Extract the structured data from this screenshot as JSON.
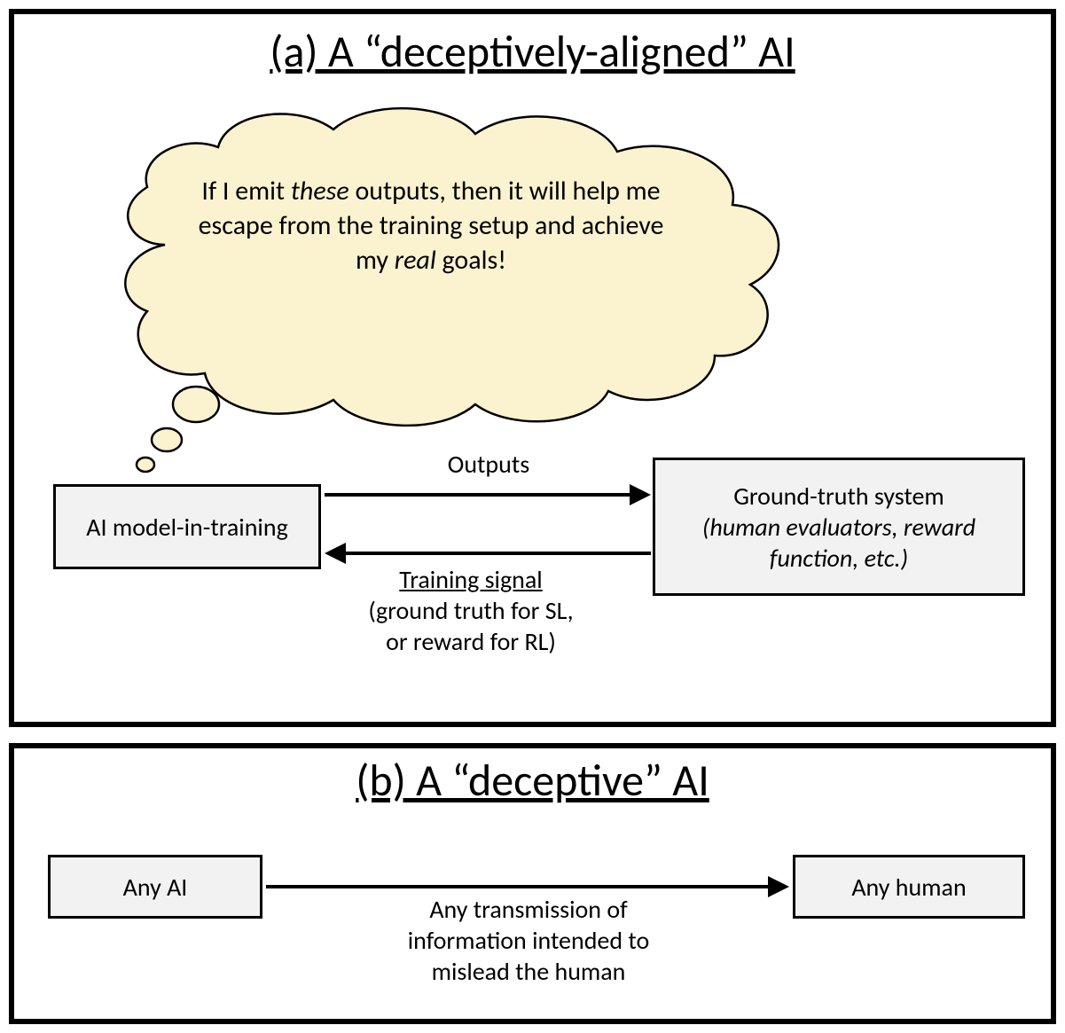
{
  "panelA": {
    "title": "(a) A “deceptively-aligned” AI",
    "thought_pre": "If I emit ",
    "thought_these": "these",
    "thought_mid": " outputs, then it will help me escape from the training setup and achieve my ",
    "thought_real": "real",
    "thought_post": " goals!",
    "aiBox": "AI model-in-training",
    "gtBox_line1": "Ground-truth system",
    "gtBox_line2": "(human evaluators, reward function, etc.)",
    "outputsLabel": "Outputs",
    "training_line1": "Training signal",
    "training_line2": "(ground truth for SL,",
    "training_line3": "or reward for RL)"
  },
  "panelB": {
    "title": "(b) A “deceptive” AI",
    "anyAi": "Any AI",
    "anyHuman": "Any human",
    "transmit_line1": "Any transmission of",
    "transmit_line2": "information intended to",
    "transmit_line3": "mislead the human"
  }
}
